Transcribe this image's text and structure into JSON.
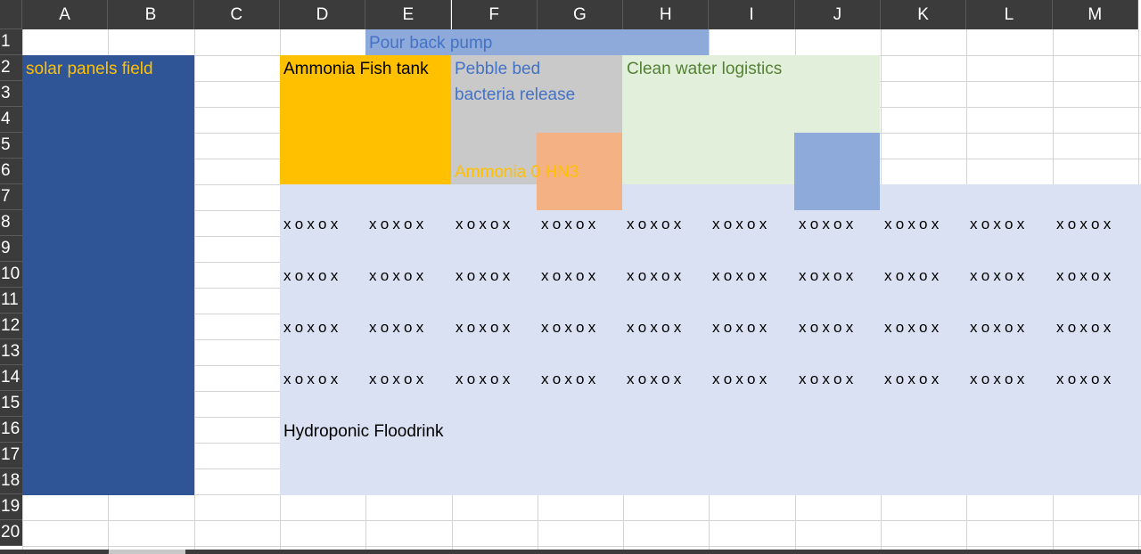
{
  "columns": [
    "A",
    "B",
    "C",
    "D",
    "E",
    "F",
    "G",
    "H",
    "I",
    "J",
    "K",
    "L",
    "M"
  ],
  "rows": [
    "1",
    "2",
    "3",
    "4",
    "5",
    "6",
    "7",
    "8",
    "9",
    "10",
    "11",
    "12",
    "13",
    "14",
    "15",
    "16",
    "17",
    "18",
    "19",
    "20"
  ],
  "labels": {
    "pour_back_pump": "Pour back pump",
    "solar_panels_field": "solar panels field",
    "ammonia_fish_tank": "Ammonia Fish tank",
    "pebble_bed": "Pebble bed",
    "bacteria_release": "bacteria release",
    "clean_water_logistics": "Clean water logistics",
    "ammonia_hn3": "Ammonia 0 HN3",
    "hydroponic_floodrink": "Hydroponic Floodrink"
  },
  "plant_pattern": "xoxox",
  "colors": {
    "solar": "#2f5597",
    "fish_tank": "#ffc000",
    "pebble": "#c9c9c9",
    "orange_block": "#f4b183",
    "clean_water": "#e2efda",
    "blue_block": "#8eaadb",
    "hydroponic": "#d9e1f2",
    "pump_bar": "#8eaadb",
    "header_bg": "#3b3b3b"
  }
}
